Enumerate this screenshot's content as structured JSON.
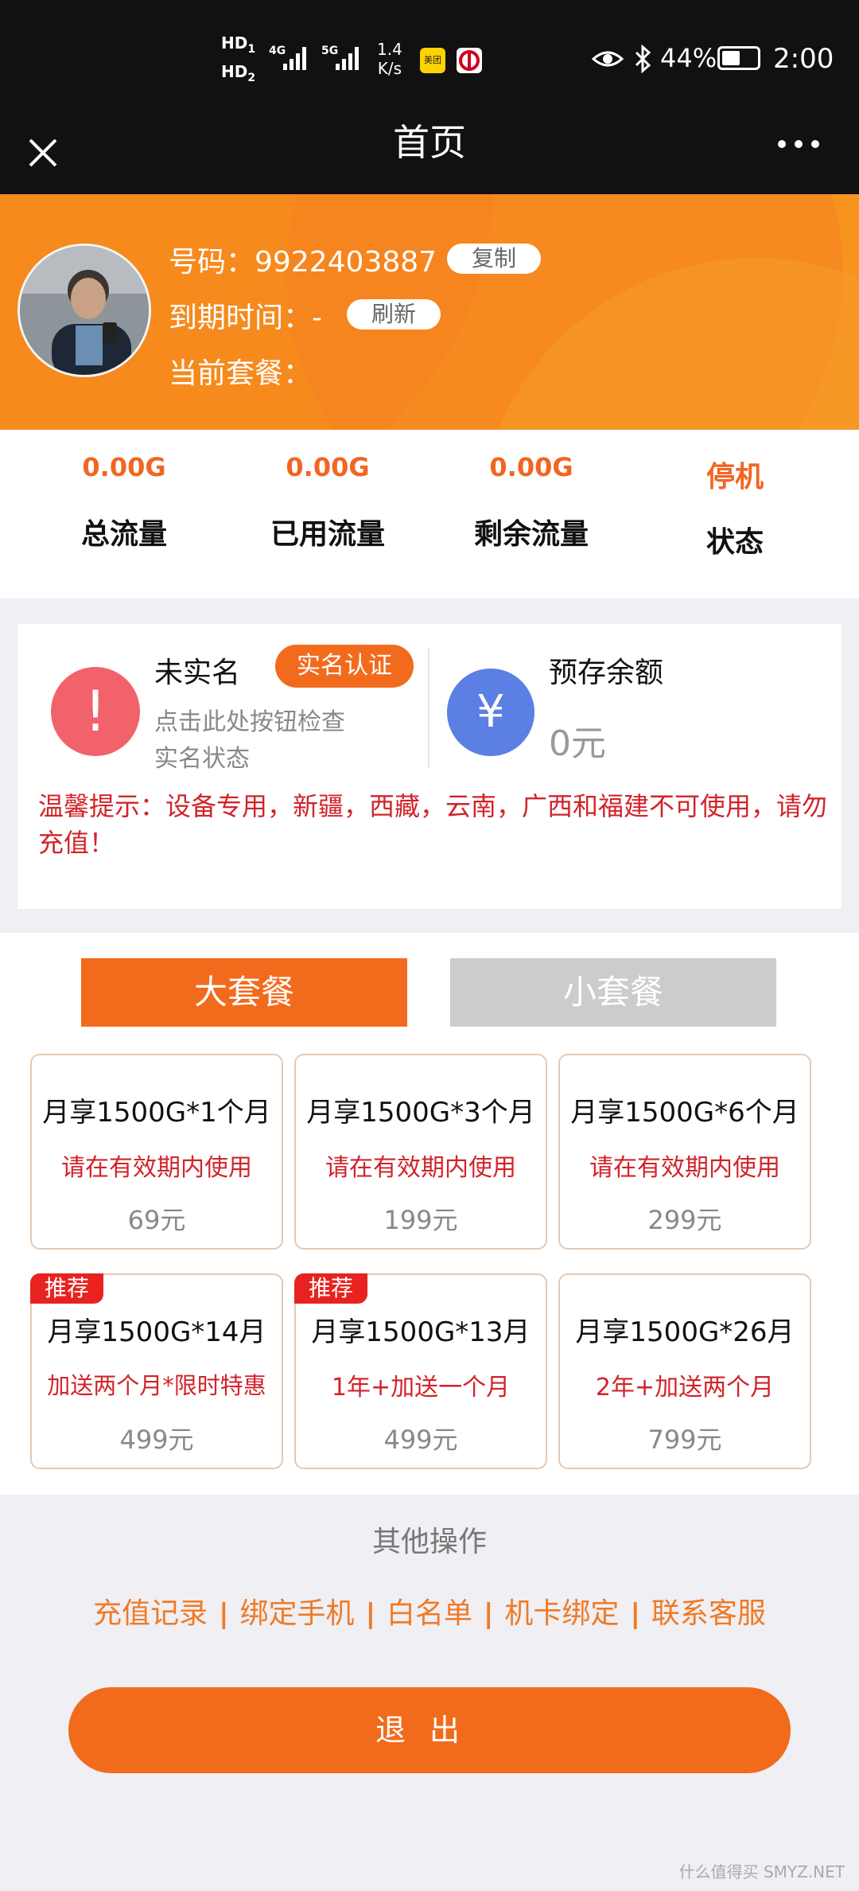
{
  "status_bar": {
    "hd1": "HD",
    "hd1_sub": "1",
    "hd2": "HD",
    "hd2_sub": "2",
    "net1": "4G",
    "net2": "5G",
    "speed_value": "1.4",
    "speed_unit": "K/s",
    "app1_label": "美团",
    "battery": "44%",
    "time": "2:00"
  },
  "title_bar": {
    "title": "首页"
  },
  "profile": {
    "number_label": "号码：",
    "number_value": "9922403887",
    "copy_button": "复制",
    "expire_label": "到期时间：",
    "expire_value": "-",
    "refresh_button": "刷新",
    "plan_label": "当前套餐："
  },
  "stats": [
    {
      "value": "0.00G",
      "label": "总流量"
    },
    {
      "value": "0.00G",
      "label": "已用流量"
    },
    {
      "value": "0.00G",
      "label": "剩余流量"
    },
    {
      "value": "停机",
      "label": "状态"
    }
  ],
  "verification": {
    "title": "未实名",
    "button": "实名认证",
    "desc_line1": "点击此处按钮检查",
    "desc_line2": "实名状态",
    "alert_glyph": "!"
  },
  "balance": {
    "title": "预存余额",
    "value": "0元",
    "glyph": "¥"
  },
  "notice": {
    "text": "温馨提示：设备专用，新疆，西藏，云南，广西和福建不可使用，请勿充值！"
  },
  "tabs": [
    {
      "label": "大套餐",
      "active": true
    },
    {
      "label": "小套餐",
      "active": false
    }
  ],
  "packages": [
    {
      "title": "月享1500G*1个月",
      "subtitle": "请在有效期内使用",
      "price": "69元",
      "badge": ""
    },
    {
      "title": "月享1500G*3个月",
      "subtitle": "请在有效期内使用",
      "price": "199元",
      "badge": ""
    },
    {
      "title": "月享1500G*6个月",
      "subtitle": "请在有效期内使用",
      "price": "299元",
      "badge": ""
    },
    {
      "title": "月享1500G*14月",
      "subtitle": "加送两个月*限时特惠",
      "price": "499元",
      "badge": "推荐"
    },
    {
      "title": "月享1500G*13月",
      "subtitle": "1年+加送一个月",
      "price": "499元",
      "badge": "推荐"
    },
    {
      "title": "月享1500G*26月",
      "subtitle": "2年+加送两个月",
      "price": "799元",
      "badge": ""
    }
  ],
  "other_ops": {
    "heading": "其他操作",
    "links": [
      "充值记录",
      "绑定手机",
      "白名单",
      "机卡绑定",
      "联系客服"
    ],
    "separator": "|"
  },
  "logout_button": "退出",
  "watermark": "什么值得买 SMYZ.NET",
  "colors": {
    "accent_orange": "#f26b1d",
    "status_red": "#d2232a",
    "alert_red": "#f2626a",
    "balance_blue": "#5b7fe3"
  }
}
